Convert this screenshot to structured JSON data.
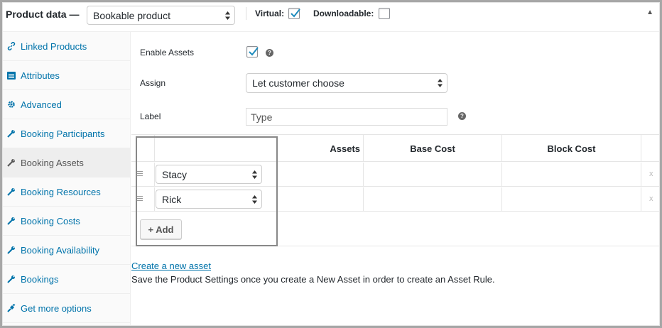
{
  "header": {
    "title": "Product data —",
    "product_type": "Bookable product",
    "virtual_label": "Virtual:",
    "virtual_checked": true,
    "downloadable_label": "Downloadable:",
    "downloadable_checked": false,
    "collapse_icon": "triangle-up-icon"
  },
  "sidebar": {
    "items": [
      {
        "label": "Linked Products",
        "icon": "link-icon",
        "active": false
      },
      {
        "label": "Attributes",
        "icon": "list-icon",
        "active": false
      },
      {
        "label": "Advanced",
        "icon": "gear-icon",
        "active": false
      },
      {
        "label": "Booking Participants",
        "icon": "wrench-icon",
        "active": false
      },
      {
        "label": "Booking Assets",
        "icon": "wrench-icon",
        "active": true
      },
      {
        "label": "Booking Resources",
        "icon": "wrench-icon",
        "active": false
      },
      {
        "label": "Booking Costs",
        "icon": "wrench-icon",
        "active": false
      },
      {
        "label": "Booking Availability",
        "icon": "wrench-icon",
        "active": false
      },
      {
        "label": "Bookings",
        "icon": "wrench-icon",
        "active": false
      },
      {
        "label": "Get more options",
        "icon": "plugin-icon",
        "active": false
      }
    ]
  },
  "form": {
    "enable_assets_label": "Enable Assets",
    "enable_assets_checked": true,
    "assign_label": "Assign",
    "assign_value": "Let customer choose",
    "label_label": "Label",
    "label_placeholder": "Type"
  },
  "table": {
    "columns": [
      "Assets",
      "Base Cost",
      "Block Cost"
    ],
    "rows": [
      {
        "asset": "Stacy",
        "base_cost": "",
        "block_cost": "",
        "remove": "x"
      },
      {
        "asset": "Rick",
        "base_cost": "",
        "block_cost": "",
        "remove": "x"
      }
    ],
    "add_button": "+ Add"
  },
  "footer": {
    "create_link": "Create a new asset",
    "note": "Save the Product Settings once you create a New Asset in order to create an Asset Rule."
  },
  "colors": {
    "link": "#0073aa",
    "check": "#1e8cbe",
    "highlight_border": "#888888",
    "frame": "#a7a7a7"
  }
}
